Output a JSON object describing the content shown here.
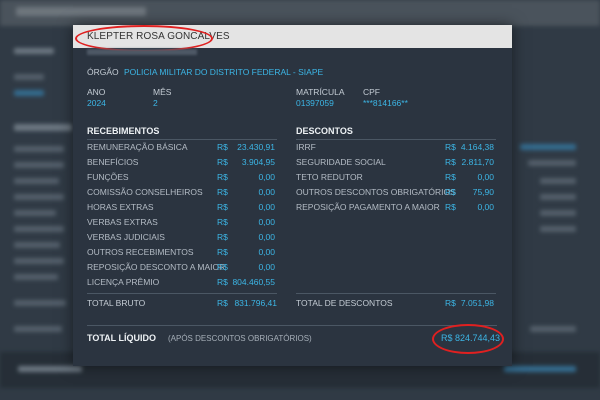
{
  "modal": {
    "employee_name": "KLEPTER ROSA GONCALVES",
    "orgao_label": "ÓRGÃO",
    "orgao_value": "POLICIA MILITAR DO DISTRITO FEDERAL - SIAPE",
    "ano_label": "ANO",
    "ano_value": "2024",
    "mes_label": "MÊS",
    "mes_value": "2",
    "matricula_label": "MATRÍCULA",
    "matricula_value": "01397059",
    "cpf_label": "CPF",
    "cpf_value": "***814166**"
  },
  "receipts": {
    "title": "RECEBIMENTOS",
    "currency": "R$",
    "rows": [
      {
        "label": "REMUNERAÇÃO BÁSICA",
        "value": "23.430,91"
      },
      {
        "label": "BENEFÍCIOS",
        "value": "3.904,95"
      },
      {
        "label": "FUNÇÕES",
        "value": "0,00"
      },
      {
        "label": "COMISSÃO CONSELHEIROS",
        "value": "0,00"
      },
      {
        "label": "HORAS EXTRAS",
        "value": "0,00"
      },
      {
        "label": "VERBAS EXTRAS",
        "value": "0,00"
      },
      {
        "label": "VERBAS JUDICIAIS",
        "value": "0,00"
      },
      {
        "label": "OUTROS RECEBIMENTOS",
        "value": "0,00"
      },
      {
        "label": "REPOSIÇÃO DESCONTO A MAIOR",
        "value": "0,00"
      },
      {
        "label": "LICENÇA PRÊMIO",
        "value": "804.460,55"
      }
    ],
    "total_label": "TOTAL BRUTO",
    "total_value": "831.796,41"
  },
  "discounts": {
    "title": "DESCONTOS",
    "currency": "R$",
    "rows": [
      {
        "label": "IRRF",
        "value": "4.164,38"
      },
      {
        "label": "SEGURIDADE SOCIAL",
        "value": "2.811,70"
      },
      {
        "label": "TETO REDUTOR",
        "value": "0,00"
      },
      {
        "label": "OUTROS DESCONTOS OBRIGATÓRIOS",
        "value": "75,90"
      },
      {
        "label": "REPOSIÇÃO PAGAMENTO A MAIOR",
        "value": "0,00"
      }
    ],
    "total_label": "TOTAL DE DESCONTOS",
    "total_value": "7.051,98"
  },
  "net": {
    "label": "TOTAL LÍQUIDO",
    "note": "(APÓS DESCONTOS OBRIGATÓRIOS)",
    "value": "R$ 824.744,43"
  },
  "colors": {
    "accent": "#3cb6e6",
    "highlight": "#e02020",
    "modal_bg": "#2b3440",
    "header_bg": "#e4e4e4"
  }
}
